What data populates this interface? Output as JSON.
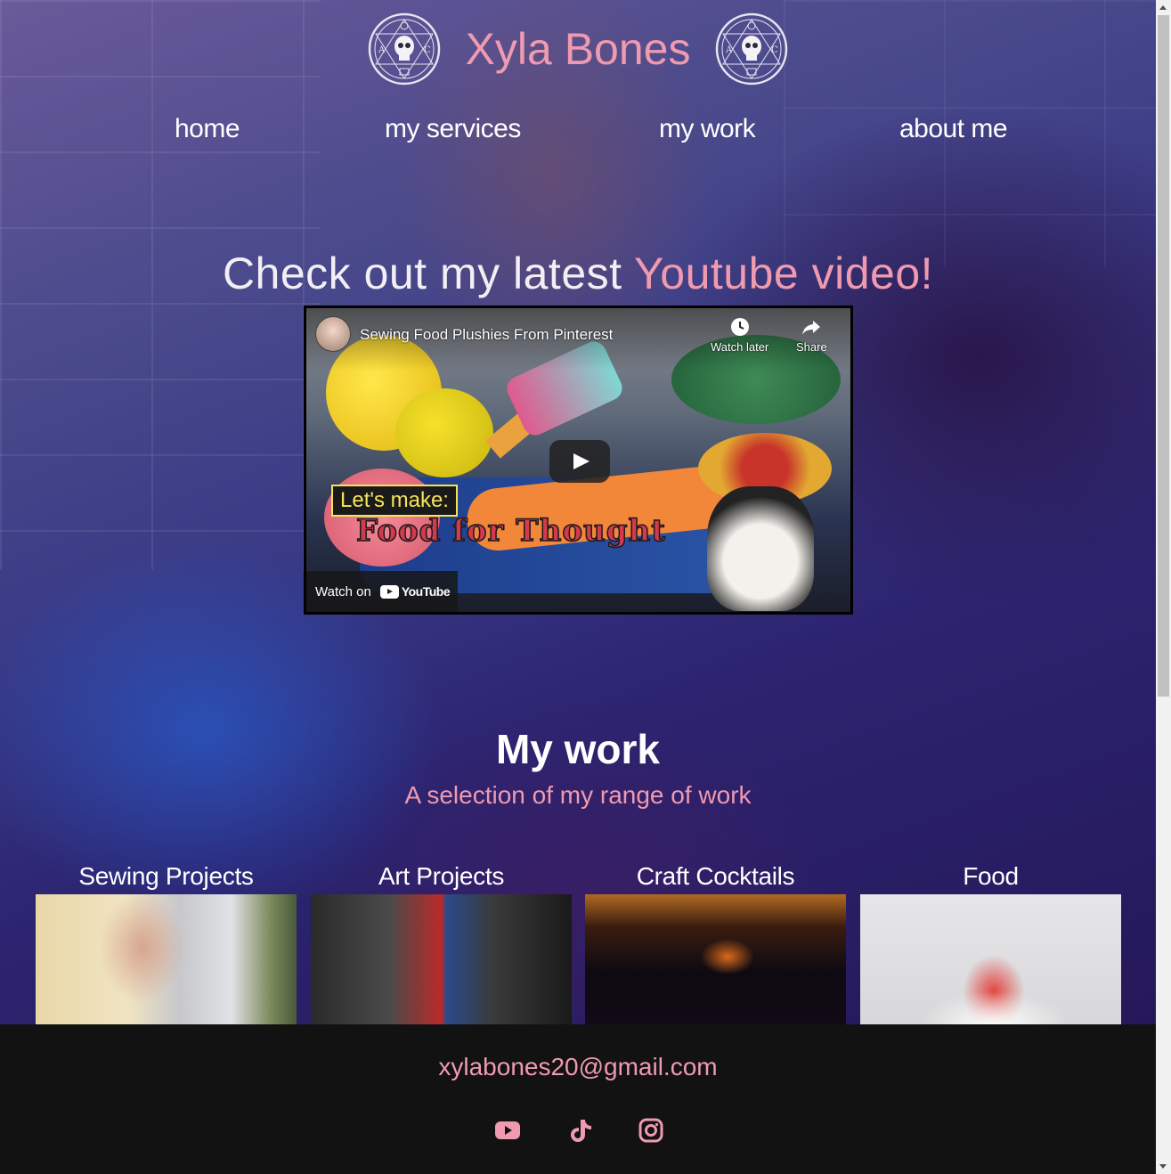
{
  "header": {
    "title": "Xyla Bones",
    "logo_left": "skull-logo",
    "logo_right": "skull-logo"
  },
  "nav": {
    "items": [
      {
        "label": "home"
      },
      {
        "label": "my services"
      },
      {
        "label": "my work"
      },
      {
        "label": "about me"
      }
    ]
  },
  "youtube": {
    "heading_main": "Check out my latest ",
    "heading_accent": "Youtube video!",
    "video_title": "Sewing Food Plushies From Pinterest",
    "watch_later": "Watch later",
    "share": "Share",
    "watch_on": "Watch on",
    "youtube_brand": "YouTube",
    "thumb_lets_make": "Let's make:",
    "thumb_food_thought": "Food for Thought"
  },
  "work": {
    "title": "My work",
    "subtitle": "A selection of my range of work",
    "cards": [
      {
        "label": "Sewing Projects"
      },
      {
        "label": "Art Projects"
      },
      {
        "label": "Craft Cocktails"
      },
      {
        "label": "Food"
      }
    ]
  },
  "footer": {
    "email": "xylabones20@gmail.com",
    "social": [
      "youtube-icon",
      "tiktok-icon",
      "instagram-icon"
    ]
  },
  "colors": {
    "accent": "#f09ab0",
    "footer_bg": "#121212",
    "text": "#ffffff"
  }
}
